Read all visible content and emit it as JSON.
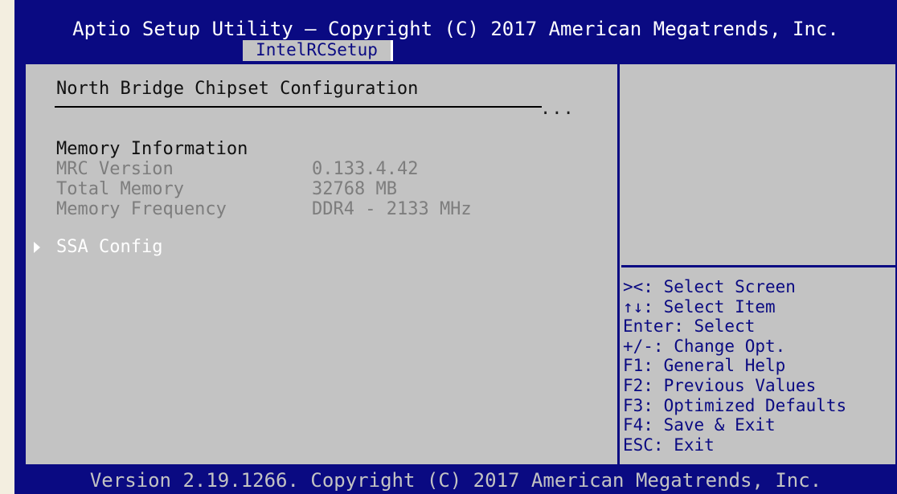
{
  "header": {
    "title": "Aptio Setup Utility – Copyright (C) 2017 American Megatrends, Inc.",
    "active_tab": "IntelRCSetup"
  },
  "main": {
    "page_title": "North Bridge Chipset Configuration",
    "dots": "...",
    "memory_heading": "Memory Information",
    "rows": [
      {
        "label": "MRC Version",
        "value": "0.133.4.42"
      },
      {
        "label": "Total Memory",
        "value": "32768 MB"
      },
      {
        "label": "Memory Frequency",
        "value": "DDR4 - 2133 MHz"
      }
    ],
    "submenu": {
      "label": "SSA Config"
    }
  },
  "help": {
    "lines": [
      "><: Select Screen",
      "↑↓: Select Item",
      "Enter: Select",
      "+/-: Change Opt.",
      "F1: General Help",
      "F2: Previous Values",
      "F3: Optimized Defaults",
      "F4: Save & Exit",
      "ESC: Exit"
    ]
  },
  "footer": {
    "text": "Version 2.19.1266. Copyright (C) 2017 American Megatrends, Inc."
  },
  "colors": {
    "bios_blue": "#0a0a82",
    "panel_gray": "#c3c3c3",
    "dim_text": "#7d7d7d",
    "highlight_text": "#ffffff"
  }
}
